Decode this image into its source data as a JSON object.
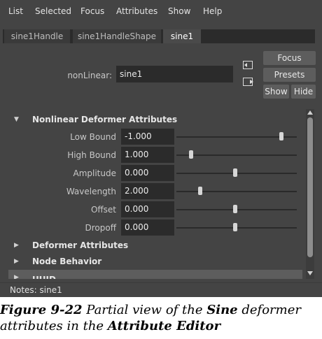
{
  "menu": [
    "List",
    "Selected",
    "Focus",
    "Attributes",
    "Show",
    "Help"
  ],
  "tabs": [
    "sine1Handle",
    "sine1HandleShape",
    "sine1"
  ],
  "active_tab": "sine1",
  "node_type_label": "nonLinear:",
  "node_name": "sine1",
  "buttons": {
    "focus": "Focus",
    "presets": "Presets",
    "show": "Show",
    "hide": "Hide"
  },
  "sections": [
    {
      "name": "Nonlinear Deformer Attributes",
      "expanded": true
    },
    {
      "name": "Deformer Attributes",
      "expanded": false
    },
    {
      "name": "Node Behavior",
      "expanded": false
    },
    {
      "name": "UUID",
      "expanded": false
    }
  ],
  "attributes": [
    {
      "label": "Low Bound",
      "value": "-1.000",
      "slider": 0.87
    },
    {
      "label": "High Bound",
      "value": "1.000",
      "slider": 0.12
    },
    {
      "label": "Amplitude",
      "value": "0.000",
      "slider": 0.49
    },
    {
      "label": "Wavelength",
      "value": "2.000",
      "slider": 0.2
    },
    {
      "label": "Offset",
      "value": "0.000",
      "slider": 0.49
    },
    {
      "label": "Dropoff",
      "value": "0.000",
      "slider": 0.49
    }
  ],
  "notes": "Notes:  sine1",
  "caption": {
    "fig": "Figure 9-22",
    "text1": "  Partial view of the ",
    "bold1": "Sine",
    "text2": " deformer attributes in the ",
    "bold2": "Attribute Editor"
  },
  "colors": {
    "panel": "#444444",
    "field": "#2b2b2b",
    "section": "#5d5d5d",
    "knob": "#d6d6d6"
  }
}
